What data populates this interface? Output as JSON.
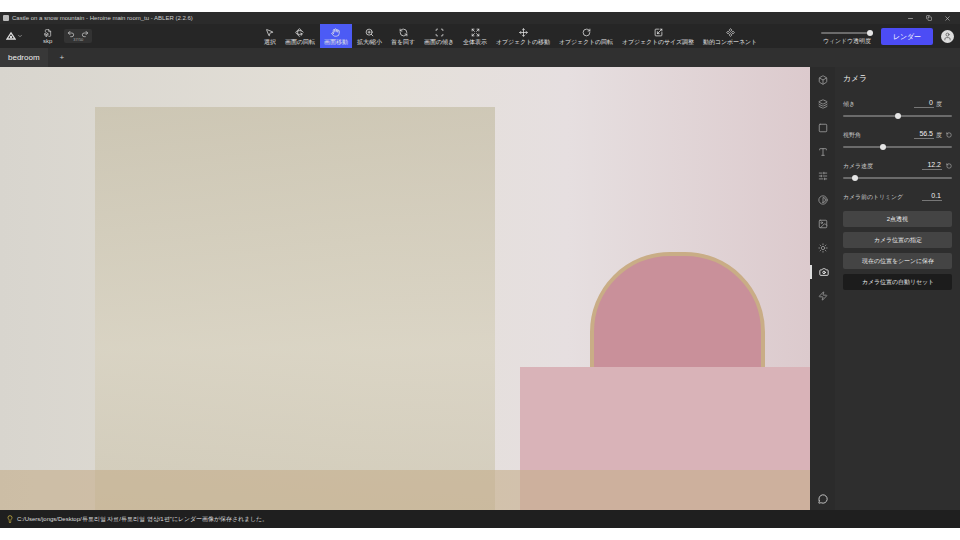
{
  "window": {
    "title": "Castle on a snow mountain - Heroine main room_tu - ABLER (2.2.6)"
  },
  "toolbar": {
    "file": "skp",
    "history": "37/50",
    "tools": [
      {
        "label": "選択",
        "selected": false
      },
      {
        "label": "画面の回転",
        "selected": false
      },
      {
        "label": "画面移動",
        "selected": true
      },
      {
        "label": "拡大/縮小",
        "selected": false
      },
      {
        "label": "首を回す",
        "selected": false
      },
      {
        "label": "画面の傾き",
        "selected": false
      },
      {
        "label": "全体表示",
        "selected": false
      },
      {
        "label": "オブジェクトの移動",
        "selected": false
      },
      {
        "label": "オブジェクトの回転",
        "selected": false
      },
      {
        "label": "オブジェクトのサイズ調整",
        "selected": false
      },
      {
        "label": "動的コンポーネント",
        "selected": false
      }
    ],
    "transparency": {
      "label": "ウィンドウ透明度",
      "level": 0.95
    },
    "render_button": "レンダー"
  },
  "tabs": [
    {
      "label": "bedroom",
      "selected": true
    }
  ],
  "tab_add": "+",
  "side_icons": [
    {
      "selected": false
    },
    {
      "selected": false
    },
    {
      "selected": false
    },
    {
      "selected": false
    },
    {
      "selected": false
    },
    {
      "selected": false
    },
    {
      "selected": false
    },
    {
      "selected": false
    },
    {
      "selected": true
    },
    {
      "selected": false
    }
  ],
  "panel": {
    "title": "カメラ",
    "fields": [
      {
        "kind": "slider",
        "label": "傾き",
        "value": "0",
        "unit": "度",
        "reset": false,
        "level": 0.5
      },
      {
        "kind": "slider",
        "label": "視野角",
        "value": "56.5",
        "unit": "度",
        "reset": true,
        "level": 0.37
      },
      {
        "kind": "slider",
        "label": "カメラ速度",
        "value": "12.2",
        "unit": "",
        "reset": true,
        "level": 0.11
      },
      {
        "kind": "number",
        "label": "カメラ前のトリミング",
        "value": "0.1",
        "unit": "",
        "reset": false,
        "level": 0
      }
    ],
    "buttons": [
      {
        "label": "2点透視",
        "highlighted": false
      },
      {
        "label": "カメラ位置の指定",
        "highlighted": false
      },
      {
        "label": "現在の位置をシーンに保存",
        "highlighted": false
      },
      {
        "label": "カメラ位置の自動リセット",
        "highlighted": true
      }
    ]
  },
  "status_bar": {
    "message": "C:/Users/jongs/Desktop/튜토리얼 자료/튜토리얼 영상/1편\"にレンダー画像が保存されました。"
  }
}
